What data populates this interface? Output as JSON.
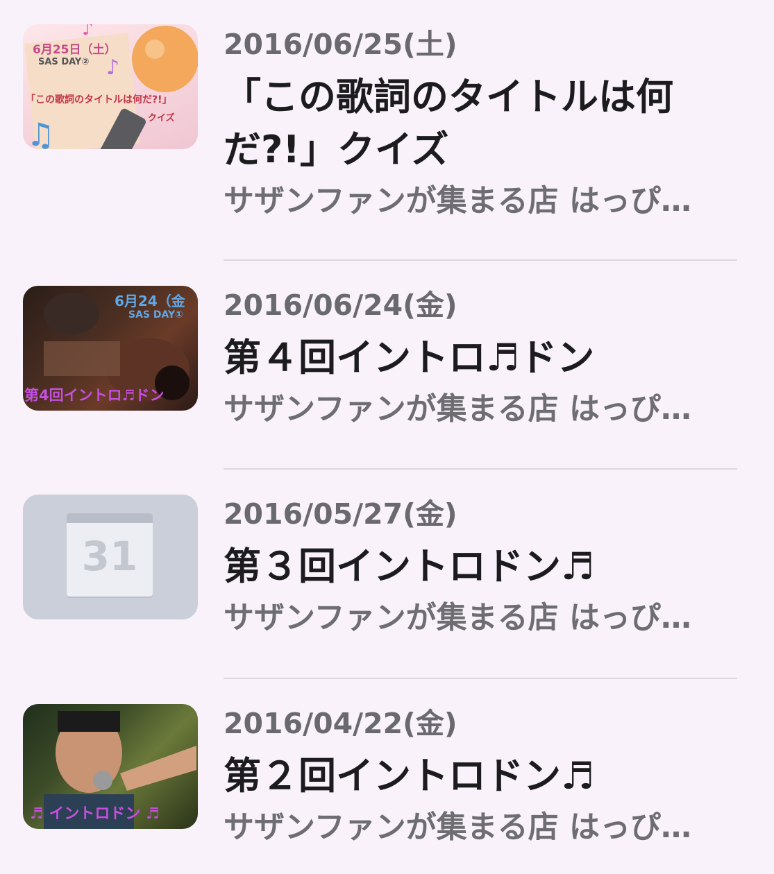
{
  "events": [
    {
      "date": "2016/06/25(土)",
      "title": "「この歌詞のタイトルは何だ?!」クイズ",
      "subtitle": "サザンファンが集まる店 はっぴ…",
      "thumb": {
        "line1": "6月25日（土）",
        "line2": "SAS DAY②",
        "line3": "「この歌詞のタイトルは何だ?!」",
        "line4": "クイズ"
      }
    },
    {
      "date": "2016/06/24(金)",
      "title": "第４回イントロ♬ドン",
      "subtitle": "サザンファンが集まる店 はっぴ…",
      "thumb": {
        "line1": "6月24（金",
        "line2": "SAS DAY①",
        "line3": "第4回イントロ♬ドン"
      }
    },
    {
      "date": "2016/05/27(金)",
      "title": "第３回イントロドン♬",
      "subtitle": "サザンファンが集まる店 はっぴ…",
      "thumb": {
        "calendar_day": "31"
      }
    },
    {
      "date": "2016/04/22(金)",
      "title": "第２回イントロドン♬",
      "subtitle": "サザンファンが集まる店 はっぴ…",
      "thumb": {
        "caption": "♬ イントロドン ♬"
      }
    }
  ]
}
